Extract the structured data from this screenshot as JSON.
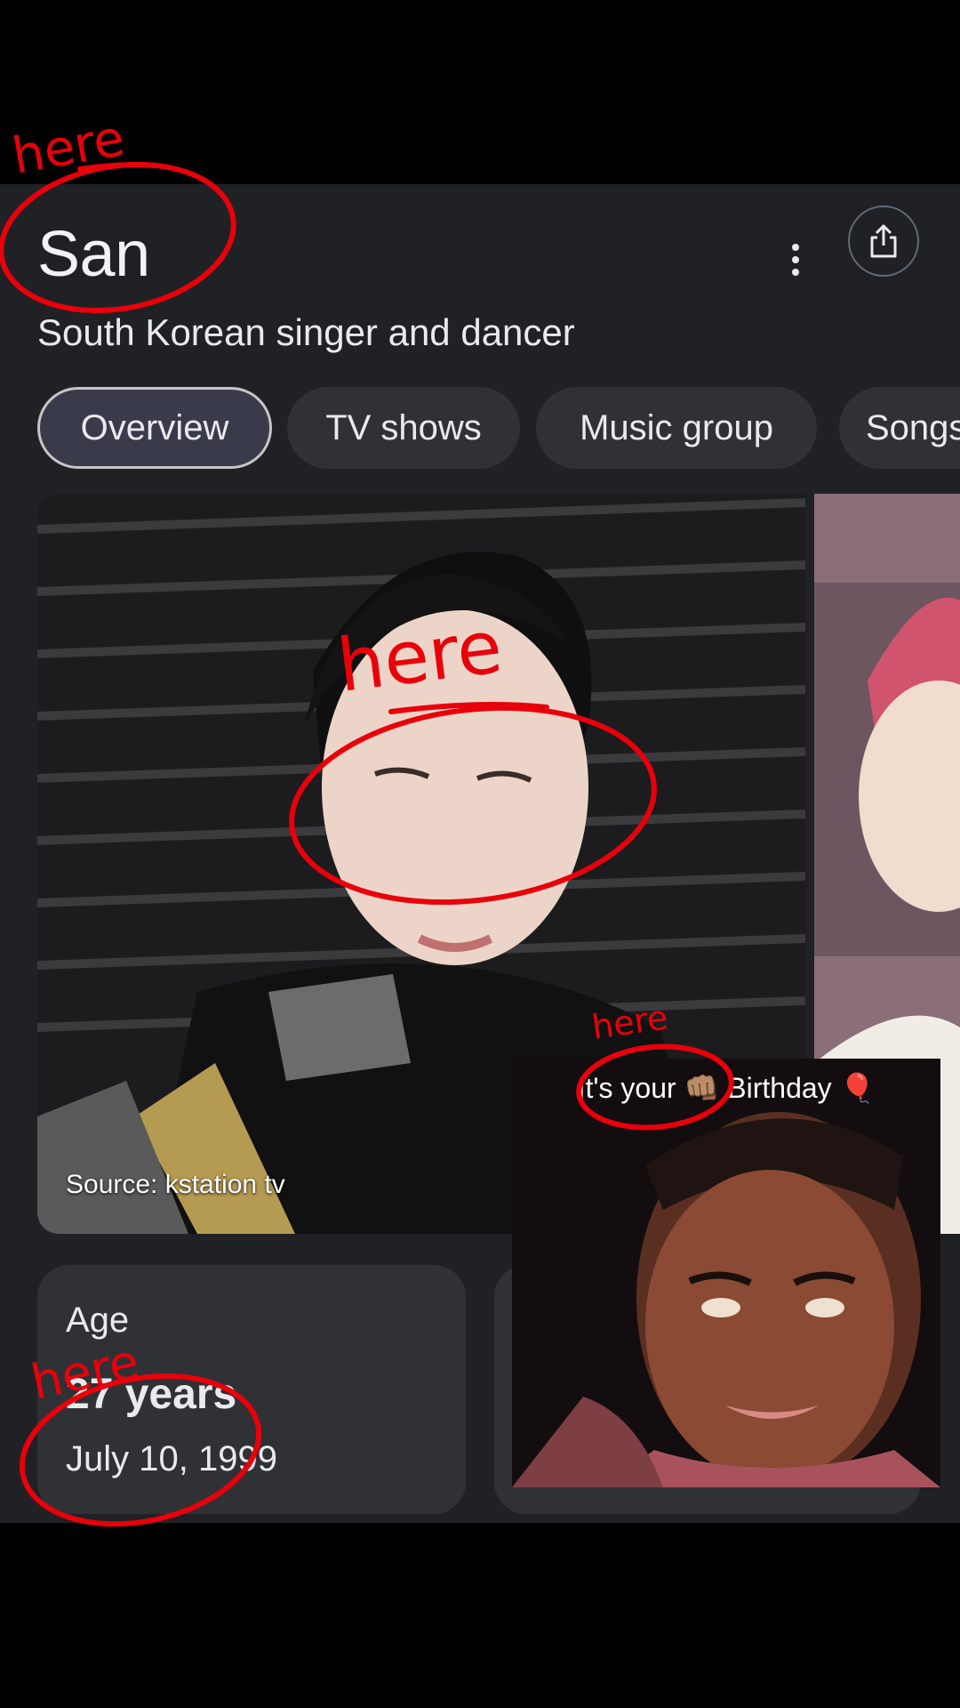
{
  "entity": {
    "title": "San",
    "subtitle": "South Korean singer and dancer"
  },
  "tabs": [
    {
      "label": "Overview",
      "active": true
    },
    {
      "label": "TV shows",
      "active": false
    },
    {
      "label": "Music group",
      "active": false
    },
    {
      "label": "Songs",
      "active": false
    }
  ],
  "photo": {
    "source_label": "Source: kstation tv"
  },
  "age_card": {
    "label": "Age",
    "value": "27 years",
    "date": "July 10, 1999"
  },
  "overlay_video": {
    "caption_before": "It's your",
    "caption_emoji": "👊🏽",
    "caption_after": "Birthday",
    "caption_balloon": "🎈"
  },
  "annotations": {
    "word": "here",
    "color": "#e8000b"
  },
  "icons": [
    "more-vert-icon",
    "share-icon"
  ]
}
